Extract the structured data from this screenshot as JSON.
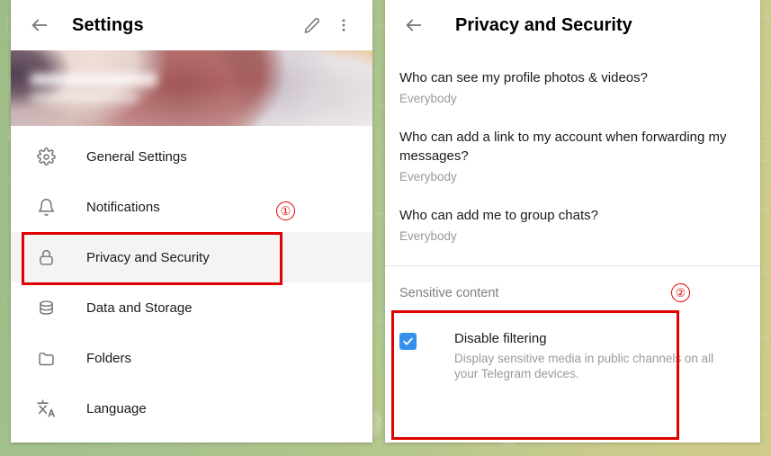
{
  "app": "Telegram Desktop — Settings",
  "background": {
    "style": "green-doodle-pattern",
    "colors": [
      "#9fbd86",
      "#b6c78c",
      "#cfcb8a"
    ]
  },
  "colors": {
    "accent_blue": "#3390ec",
    "annotation_red": "#e00000",
    "text_primary": "#1a1a1a",
    "text_secondary": "#9a9a9a",
    "selected_row": "#f4f4f5",
    "divider": "#e4e4e6"
  },
  "left_panel": {
    "header": {
      "back_icon": "back-arrow-icon",
      "title": "Settings",
      "edit_icon": "pencil-icon",
      "menu_icon": "more-vertical-icon"
    },
    "profile_banner": {
      "image_description": "blurred anime artwork",
      "name_redacted": true,
      "phone_redacted": true
    },
    "menu_items": [
      {
        "icon": "gear-icon",
        "label": "General Settings",
        "selected": false
      },
      {
        "icon": "bell-icon",
        "label": "Notifications",
        "selected": false
      },
      {
        "icon": "lock-icon",
        "label": "Privacy and Security",
        "selected": true
      },
      {
        "icon": "database-icon",
        "label": "Data and Storage",
        "selected": false
      },
      {
        "icon": "folder-icon",
        "label": "Folders",
        "selected": false
      },
      {
        "icon": "translate-icon",
        "label": "Language",
        "selected": false
      }
    ]
  },
  "right_panel": {
    "header": {
      "back_icon": "back-arrow-icon",
      "title": "Privacy and Security"
    },
    "privacy_rows": [
      {
        "question": "Who can see my profile photos & videos?",
        "value": "Everybody"
      },
      {
        "question": "Who can add a link to my account when forwarding my messages?",
        "value": "Everybody"
      },
      {
        "question": "Who can add me to group chats?",
        "value": "Everybody"
      }
    ],
    "sensitive_content": {
      "heading": "Sensitive content",
      "checkbox_checked": true,
      "option_title": "Disable filtering",
      "option_description": "Display sensitive media in public channels on all your Telegram devices."
    }
  },
  "annotations": {
    "marker_1": "①",
    "marker_2": "②",
    "box_1_target": "Privacy and Security menu row",
    "box_2_target": "Sensitive content section"
  }
}
